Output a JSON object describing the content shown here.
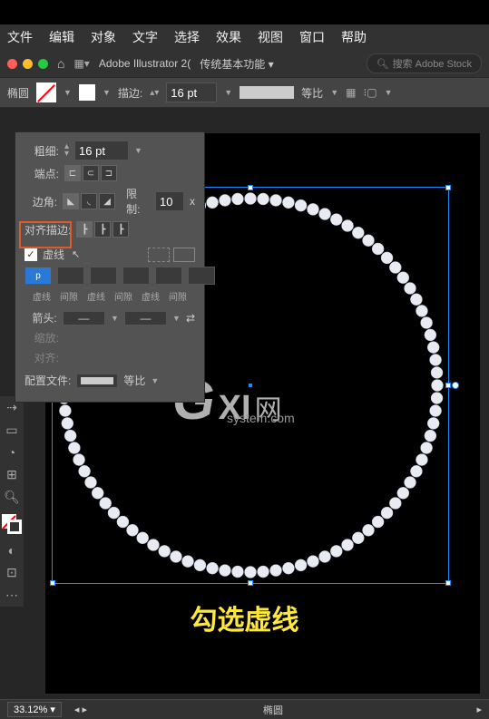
{
  "menubar": {
    "items": [
      "文件",
      "编辑",
      "对象",
      "文字",
      "选择",
      "效果",
      "视图",
      "窗口",
      "帮助"
    ]
  },
  "titlebar": {
    "doc_name": "Adobe Illustrator 2(",
    "workspace": "传统基本功能",
    "search_placeholder": "搜索 Adobe Stock"
  },
  "control_bar": {
    "object_label": "椭圆",
    "stroke_label": "描边:",
    "stroke_weight": "16 pt",
    "profile_label": "等比"
  },
  "stroke_panel": {
    "weight_label": "粗细:",
    "weight_value": "16 pt",
    "cap_label": "端点:",
    "corner_label": "边角:",
    "limit_label": "限制:",
    "limit_value": "10",
    "limit_suffix": "x",
    "align_label": "对齐描边:",
    "dashed_label": "虚线",
    "dashed_checked": true,
    "dash_value": "p",
    "dash_labels": [
      "虚线",
      "间隙",
      "虚线",
      "间隙",
      "虚线",
      "间隙"
    ],
    "arrow_label": "箭头:",
    "scale_label": "缩放:",
    "align_arrow_label": "对齐:",
    "profile_label": "配置文件:",
    "profile_value": "等比"
  },
  "caption": "勾选虚线",
  "watermark": {
    "brand": "GXI",
    "tag": "网",
    "domain": "system.com"
  },
  "status": {
    "zoom": "33.12%",
    "selection_label": "椭圆"
  }
}
